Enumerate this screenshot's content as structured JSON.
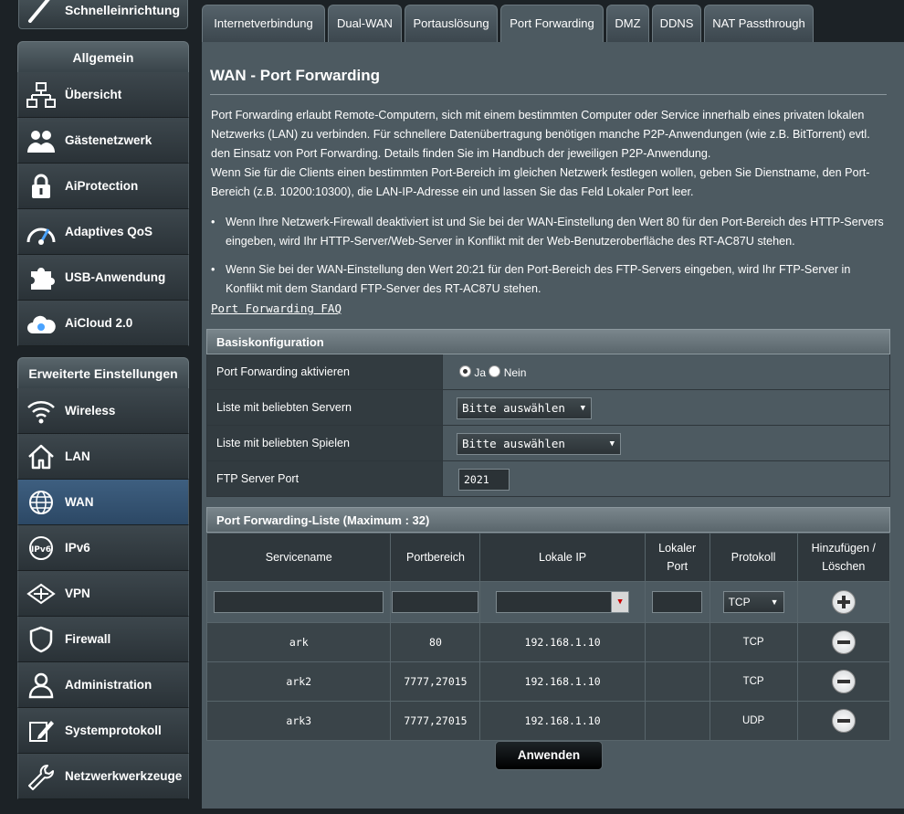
{
  "sidebar": {
    "quick_setup": "Schnelleinrichtung",
    "general_header": "Allgemein",
    "general_items": [
      {
        "label": "Übersicht",
        "icon": "network-map-icon"
      },
      {
        "label": "Gästenetzwerk",
        "icon": "guest-network-icon"
      },
      {
        "label": "AiProtection",
        "icon": "lock-icon"
      },
      {
        "label": "Adaptives QoS",
        "icon": "speedometer-icon"
      },
      {
        "label": "USB-Anwendung",
        "icon": "puzzle-icon"
      },
      {
        "label": "AiCloud 2.0",
        "icon": "cloud-icon"
      }
    ],
    "advanced_header": "Erweiterte Einstellungen",
    "advanced_items": [
      {
        "label": "Wireless",
        "icon": "wifi-icon"
      },
      {
        "label": "LAN",
        "icon": "home-icon"
      },
      {
        "label": "WAN",
        "icon": "globe-icon",
        "active": true
      },
      {
        "label": "IPv6",
        "icon": "ipv6-icon"
      },
      {
        "label": "VPN",
        "icon": "vpn-icon"
      },
      {
        "label": "Firewall",
        "icon": "shield-icon"
      },
      {
        "label": "Administration",
        "icon": "user-icon"
      },
      {
        "label": "Systemprotokoll",
        "icon": "edit-icon"
      },
      {
        "label": "Netzwerkwerkzeuge",
        "icon": "wrench-icon"
      }
    ]
  },
  "tabs": [
    {
      "label": "Internetverbindung",
      "active": false
    },
    {
      "label": "Dual-WAN",
      "active": false
    },
    {
      "label": "Portauslösung",
      "active": false
    },
    {
      "label": "Port Forwarding",
      "active": true
    },
    {
      "label": "DMZ",
      "active": false
    },
    {
      "label": "DDNS",
      "active": false
    },
    {
      "label": "NAT Passthrough",
      "active": false
    }
  ],
  "page": {
    "title": "WAN - Port Forwarding",
    "description_1": "Port Forwarding erlaubt Remote-Computern, sich mit einem bestimmten Computer oder Service innerhalb eines privaten lokalen Netzwerks (LAN) zu verbinden. Für schnellere Datenübertragung benötigen manche P2P-Anwendungen (wie z.B. BitTorrent) evtl. den Einsatz von Port Forwarding. Details finden Sie im Handbuch der jeweiligen P2P-Anwendung.",
    "description_2": "Wenn Sie für die Clients einen bestimmten Port-Bereich im gleichen Netzwerk festlegen wollen, geben Sie Dienstname, den Port-Bereich (z.B. 10200:10300), die LAN-IP-Adresse ein und lassen Sie das Feld Lokaler Port leer.",
    "bullet_1": "Wenn Ihre Netzwerk-Firewall deaktiviert ist und Sie bei der WAN-Einstellung den Wert 80 für den Port-Bereich des HTTP-Servers eingeben, wird Ihr HTTP-Server/Web-Server in Konflikt mit der Web-Benutzeroberfläche des RT-AC87U stehen.",
    "bullet_2": "Wenn Sie bei der WAN-Einstellung den Wert 20:21 für den Port-Bereich des FTP-Servers eingeben, wird Ihr FTP-Server in Konflikt mit dem Standard FTP-Server des RT-AC87U stehen.",
    "faq_link": "Port Forwarding FAQ"
  },
  "basic_config": {
    "header": "Basiskonfiguration",
    "enable_label": "Port Forwarding aktivieren",
    "enable_yes": "Ja",
    "enable_no": "Nein",
    "enable_value": "Ja",
    "servers_label": "Liste mit beliebten Servern",
    "servers_select": "Bitte auswählen",
    "games_label": "Liste mit beliebten Spielen",
    "games_select": "Bitte auswählen",
    "ftp_label": "FTP Server Port",
    "ftp_value": "2021"
  },
  "forward_list": {
    "header": "Port Forwarding-Liste (Maximum : 32)",
    "columns": [
      "Servicename",
      "Portbereich",
      "Lokale IP",
      "Lokaler Port",
      "Protokoll",
      "Hinzufügen / Löschen"
    ],
    "new_protocol": "TCP",
    "rows": [
      {
        "service": "ark",
        "ports": "80",
        "ip": "192.168.1.10",
        "local_port": "",
        "protocol": "TCP"
      },
      {
        "service": "ark2",
        "ports": "7777,27015",
        "ip": "192.168.1.10",
        "local_port": "",
        "protocol": "TCP"
      },
      {
        "service": "ark3",
        "ports": "7777,27015",
        "ip": "192.168.1.10",
        "local_port": "",
        "protocol": "UDP"
      }
    ]
  },
  "apply_label": "Anwenden"
}
